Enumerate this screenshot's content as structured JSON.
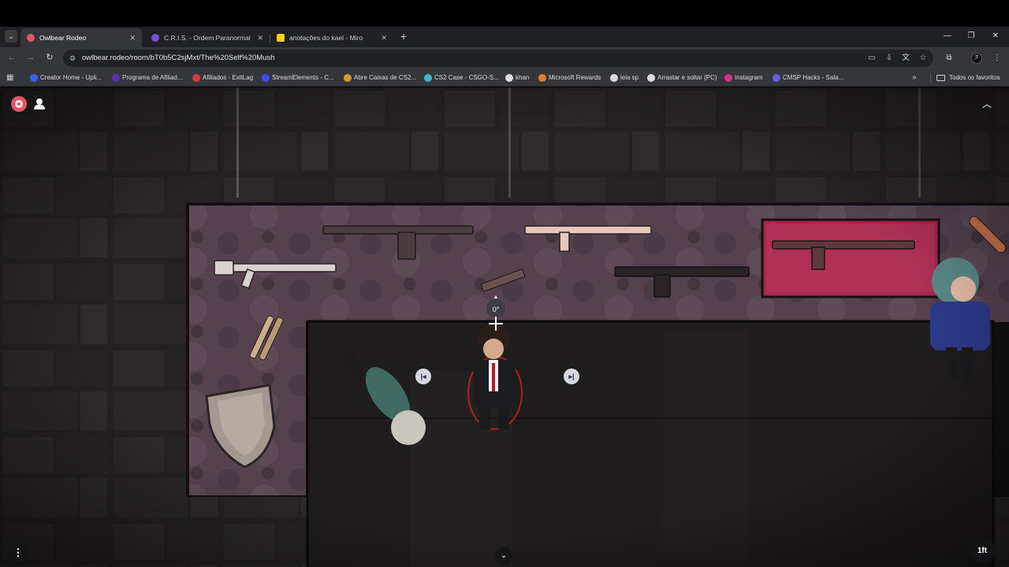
{
  "browser": {
    "tabs": [
      {
        "title": "Owlbear Rodeo",
        "active": true,
        "favicon_color": "#e2566b"
      },
      {
        "title": "C.R.I.S. - Ordem Paranormal",
        "active": false,
        "favicon_color": "#7b4fd6"
      },
      {
        "title": "anotações do kael - Miro",
        "active": false,
        "favicon_color": "#f7d117"
      }
    ],
    "tab_close_glyph": "✕",
    "new_tab_glyph": "+",
    "url": "owlbear.rodeo/room/bT0b5C2sjMxt/The%20Self%20Mush",
    "bookmarks": [
      {
        "label": "Creator Home - Upli...",
        "color": "#3a63ff"
      },
      {
        "label": "Programa de Afiliad...",
        "color": "#5a2fb5"
      },
      {
        "label": "Afiliados - ExitLag",
        "color": "#d63a3a"
      },
      {
        "label": "StreamElements - C...",
        "color": "#3b4cff"
      },
      {
        "label": "Abre Caixas de CS2...",
        "color": "#d39a2a"
      },
      {
        "label": "CS2 Case - CSGO-S...",
        "color": "#3fb7c9"
      },
      {
        "label": "khan",
        "color": "#dddddd"
      },
      {
        "label": "Microsoft Rewards",
        "color": "#e87b2a"
      },
      {
        "label": "leia sp",
        "color": "#dddddd"
      },
      {
        "label": "Arrastar e soltar (PC)",
        "color": "#dddddd"
      },
      {
        "label": "Instagram",
        "color": "#d6338a"
      },
      {
        "label": "CMSP Hacks - Sala...",
        "color": "#6a5fd6"
      }
    ],
    "bookmarks_more_glyph": "»",
    "all_bookmarks_label": "Todos os favoritos"
  },
  "map": {
    "rotation_label": "0°",
    "grid_scale": "1ft"
  },
  "colors": {
    "accent": "#e2566b",
    "stone": "#2a2627",
    "armory_wall": "#5b4656",
    "armory_floor": "#4a3a48",
    "display_case": "#a8244a"
  },
  "icons": {
    "logo": "owlbear-logo-icon",
    "players": "user-icon",
    "collapse": "chevron-up-icon",
    "menu": "more-vertical-icon",
    "expand": "chevron-down-icon",
    "handle_left": "align-left-icon",
    "handle_right": "align-right-icon"
  }
}
